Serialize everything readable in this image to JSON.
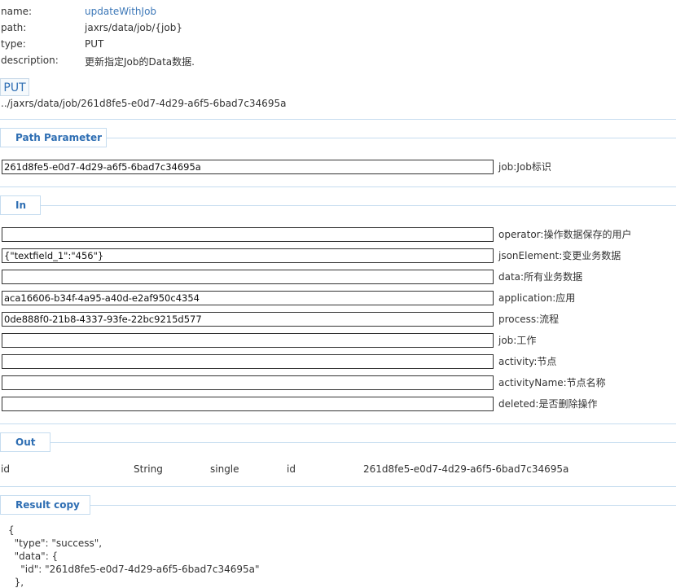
{
  "meta": {
    "name_label": "name:",
    "name_value": "updateWithJob",
    "path_label": "path:",
    "path_value": "jaxrs/data/job/{job}",
    "type_label": "type:",
    "type_value": "PUT",
    "description_label": "description:",
    "description_value": "更新指定Job的Data数据."
  },
  "request": {
    "method_button": "PUT",
    "url": "../jaxrs/data/job/261d8fe5-e0d7-4d29-a6f5-6bad7c34695a"
  },
  "path_parameter": {
    "title": "Path Parameter",
    "fields": [
      {
        "value": "261d8fe5-e0d7-4d29-a6f5-6bad7c34695a",
        "label": "job:Job标识"
      }
    ]
  },
  "in": {
    "title": "In",
    "fields": [
      {
        "value": "",
        "label": "operator:操作数据保存的用户"
      },
      {
        "value": "{\"textfield_1\":\"456\"}",
        "label": "jsonElement:变更业务数据"
      },
      {
        "value": "",
        "label": "data:所有业务数据"
      },
      {
        "value": "aca16606-b34f-4a95-a40d-e2af950c4354",
        "label": "application:应用"
      },
      {
        "value": "0de888f0-21b8-4337-93fe-22bc9215d577",
        "label": "process:流程"
      },
      {
        "value": "",
        "label": "job:工作"
      },
      {
        "value": "",
        "label": "activity:节点"
      },
      {
        "value": "",
        "label": "activityName:节点名称"
      },
      {
        "value": "",
        "label": "deleted:是否删除操作"
      }
    ]
  },
  "out": {
    "title": "Out",
    "rows": [
      {
        "name": "id",
        "type": "String",
        "multiplicity": "single",
        "description": "id",
        "value": "261d8fe5-e0d7-4d29-a6f5-6bad7c34695a"
      }
    ]
  },
  "result": {
    "title": "Result copy",
    "lines": [
      "{",
      "  \"type\": \"success\",",
      "  \"data\": {",
      "    \"id\": \"261d8fe5-e0d7-4d29-a6f5-6bad7c34695a\"",
      "  },"
    ]
  }
}
